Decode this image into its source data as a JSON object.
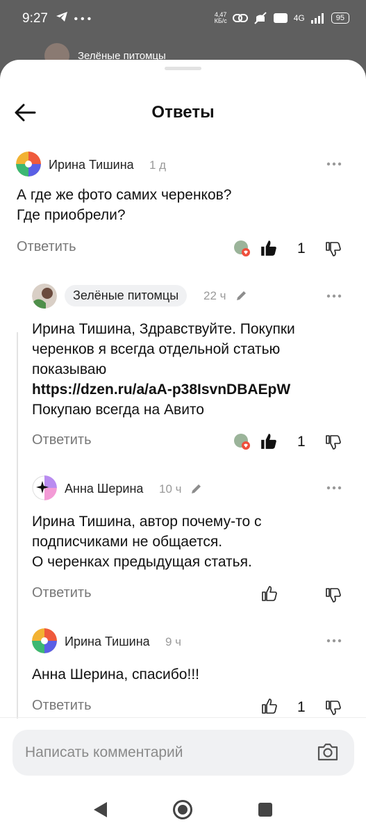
{
  "status": {
    "time": "9:27",
    "left_icons": [
      "telegram-icon",
      "more-dots-icon"
    ],
    "speed_value": "4,47",
    "speed_unit": "КБ/с",
    "network": "4G",
    "battery": "95"
  },
  "background_header": {
    "channel": "Зелёные питомцы"
  },
  "sheet": {
    "title": "Ответы"
  },
  "comments": [
    {
      "author": "Ирина Тишина",
      "time": "1 д",
      "lines": [
        "А где же фото самих черенков?",
        "Где приобрели?"
      ],
      "reply_label": "Ответить",
      "likes": "1",
      "liked": true
    },
    {
      "author": "Зелёные питомцы",
      "time": "22 ч",
      "edited": true,
      "lines": [
        "Ирина Тишина, Здравствуйте. Покупки",
        "черенков я всегда отдельной статью",
        "показываю",
        "https://dzen.ru/a/aA-p38IsvnDBAEpW",
        "Покупаю всегда на Авито"
      ],
      "reply_label": "Ответить",
      "likes": "1",
      "liked": true
    },
    {
      "author": "Анна Шерина",
      "time": "10 ч",
      "edited": true,
      "lines": [
        "Ирина Тишина, автор почему-то с",
        "подписчиками не общается.",
        "О черенках предыдущая статья."
      ],
      "reply_label": "Ответить",
      "likes": "",
      "liked": false
    },
    {
      "author": "Ирина Тишина",
      "time": "9 ч",
      "lines": [
        "Анна Шерина, спасибо!!!"
      ],
      "reply_label": "Ответить",
      "likes": "1",
      "liked": false
    }
  ],
  "input": {
    "placeholder": "Написать комментарий"
  },
  "navigation": [
    "back-triangle-icon",
    "home-circle-icon",
    "recents-square-icon"
  ],
  "colors": {
    "sheet_bg": "#ffffff",
    "input_bg": "#f0f1f3",
    "muted": "#9a9a9a",
    "text": "#111111"
  }
}
